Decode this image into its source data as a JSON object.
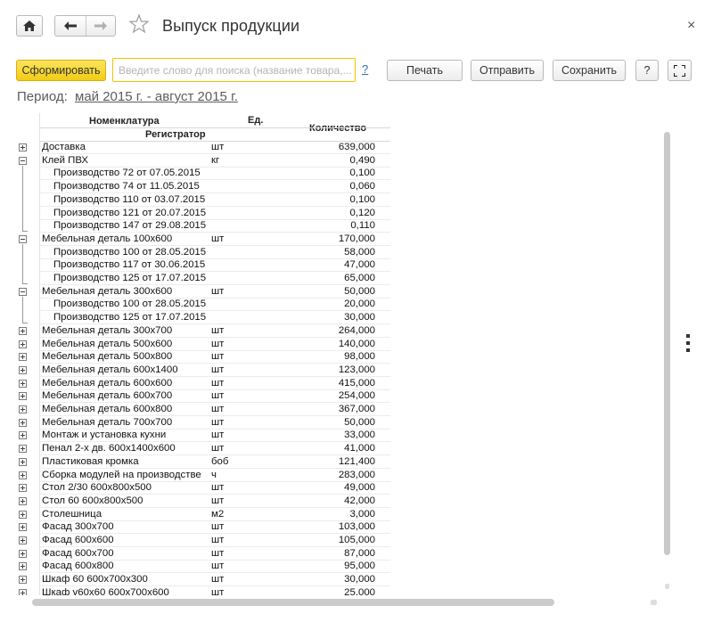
{
  "header": {
    "title": "Выпуск продукции",
    "close_glyph": "×",
    "home_icon": "home-icon",
    "back_icon": "arrow-left-icon",
    "forward_icon": "arrow-right-icon",
    "favorite_icon": "star-icon"
  },
  "toolbar": {
    "generate_label": "Сформировать",
    "search_placeholder": "Введите слово для поиска (название товара,...",
    "help_link": "?",
    "print_label": "Печать",
    "send_label": "Отправить",
    "save_label": "Сохранить",
    "help_label": "?",
    "accent_color": "#f2cb14"
  },
  "period": {
    "label": "Период:",
    "value": "май 2015 г. - август 2015 г."
  },
  "report": {
    "columns": {
      "nomenclature": "Номенклатура",
      "registrar": "Регистратор",
      "unit": "Ед.",
      "quantity": "Количество"
    },
    "rows": [
      {
        "name": "Доставка",
        "unit": "шт",
        "qty": "639,000",
        "level": 0,
        "toggle": "plus"
      },
      {
        "name": "Клей ПВХ",
        "unit": "кг",
        "qty": "0,490",
        "level": 0,
        "toggle": "minus"
      },
      {
        "name": "Производство 72 от 07.05.2015",
        "unit": "",
        "qty": "0,100",
        "level": 1,
        "toggle": ""
      },
      {
        "name": "Производство 74 от 11.05.2015",
        "unit": "",
        "qty": "0,060",
        "level": 1,
        "toggle": ""
      },
      {
        "name": "Производство 110 от 03.07.2015",
        "unit": "",
        "qty": "0,100",
        "level": 1,
        "toggle": ""
      },
      {
        "name": "Производство 121 от 20.07.2015",
        "unit": "",
        "qty": "0,120",
        "level": 1,
        "toggle": ""
      },
      {
        "name": "Производство 147 от 29.08.2015",
        "unit": "",
        "qty": "0,110",
        "level": 1,
        "toggle": ""
      },
      {
        "name": "Мебельная деталь 100х600",
        "unit": "шт",
        "qty": "170,000",
        "level": 0,
        "toggle": "minus"
      },
      {
        "name": "Производство 100 от 28.05.2015",
        "unit": "",
        "qty": "58,000",
        "level": 1,
        "toggle": ""
      },
      {
        "name": "Производство 117 от 30.06.2015",
        "unit": "",
        "qty": "47,000",
        "level": 1,
        "toggle": ""
      },
      {
        "name": "Производство 125 от 17.07.2015",
        "unit": "",
        "qty": "65,000",
        "level": 1,
        "toggle": ""
      },
      {
        "name": "Мебельная деталь 300х600",
        "unit": "шт",
        "qty": "50,000",
        "level": 0,
        "toggle": "minus"
      },
      {
        "name": "Производство 100 от 28.05.2015",
        "unit": "",
        "qty": "20,000",
        "level": 1,
        "toggle": ""
      },
      {
        "name": "Производство 125 от 17.07.2015",
        "unit": "",
        "qty": "30,000",
        "level": 1,
        "toggle": ""
      },
      {
        "name": "Мебельная деталь 300х700",
        "unit": "шт",
        "qty": "264,000",
        "level": 0,
        "toggle": "plus"
      },
      {
        "name": "Мебельная деталь 500х600",
        "unit": "шт",
        "qty": "140,000",
        "level": 0,
        "toggle": "plus"
      },
      {
        "name": "Мебельная деталь 500х800",
        "unit": "шт",
        "qty": "98,000",
        "level": 0,
        "toggle": "plus"
      },
      {
        "name": "Мебельная деталь 600х1400",
        "unit": "шт",
        "qty": "123,000",
        "level": 0,
        "toggle": "plus"
      },
      {
        "name": "Мебельная деталь 600х600",
        "unit": "шт",
        "qty": "415,000",
        "level": 0,
        "toggle": "plus"
      },
      {
        "name": "Мебельная деталь 600х700",
        "unit": "шт",
        "qty": "254,000",
        "level": 0,
        "toggle": "plus"
      },
      {
        "name": "Мебельная деталь 600х800",
        "unit": "шт",
        "qty": "367,000",
        "level": 0,
        "toggle": "plus"
      },
      {
        "name": "Мебельная деталь 700х700",
        "unit": "шт",
        "qty": "50,000",
        "level": 0,
        "toggle": "plus"
      },
      {
        "name": "Монтаж и установка кухни",
        "unit": "шт",
        "qty": "33,000",
        "level": 0,
        "toggle": "plus"
      },
      {
        "name": "Пенал 2-х дв. 600х1400х600",
        "unit": "шт",
        "qty": "41,000",
        "level": 0,
        "toggle": "plus"
      },
      {
        "name": "Пластиковая кромка",
        "unit": "боб",
        "qty": "121,400",
        "level": 0,
        "toggle": "plus"
      },
      {
        "name": "Сборка модулей на производстве",
        "unit": "ч",
        "qty": "283,000",
        "level": 0,
        "toggle": "plus"
      },
      {
        "name": "Стол 2/30 600х800х500",
        "unit": "шт",
        "qty": "49,000",
        "level": 0,
        "toggle": "plus"
      },
      {
        "name": "Стол 60 600х800х500",
        "unit": "шт",
        "qty": "42,000",
        "level": 0,
        "toggle": "plus"
      },
      {
        "name": "Столешница",
        "unit": "м2",
        "qty": "3,000",
        "level": 0,
        "toggle": "plus"
      },
      {
        "name": "Фасад 300х700",
        "unit": "шт",
        "qty": "103,000",
        "level": 0,
        "toggle": "plus"
      },
      {
        "name": "Фасад 600х600",
        "unit": "шт",
        "qty": "105,000",
        "level": 0,
        "toggle": "plus"
      },
      {
        "name": "Фасад 600х700",
        "unit": "шт",
        "qty": "87,000",
        "level": 0,
        "toggle": "plus"
      },
      {
        "name": "Фасад 600х800",
        "unit": "шт",
        "qty": "95,000",
        "level": 0,
        "toggle": "plus"
      },
      {
        "name": "Шкаф 60 600х700х300",
        "unit": "шт",
        "qty": "30,000",
        "level": 0,
        "toggle": "plus"
      },
      {
        "name": "Шкаф у60х60 600х700х600",
        "unit": "шт",
        "qty": "25,000",
        "level": 0,
        "toggle": "plus"
      }
    ]
  }
}
